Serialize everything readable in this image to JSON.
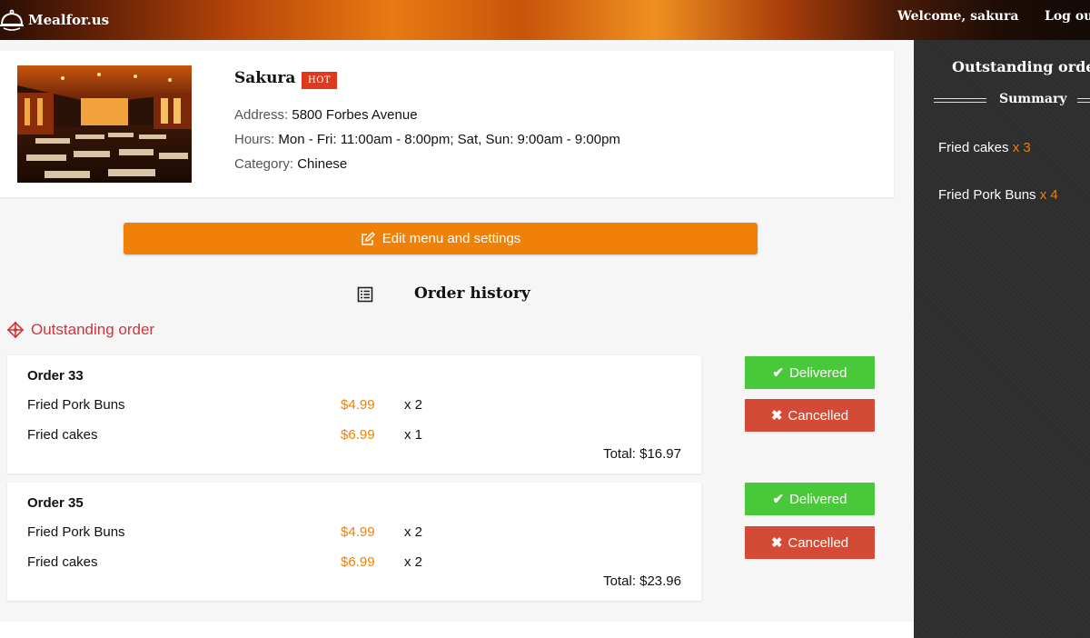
{
  "header": {
    "brand": "Mealfor.us",
    "welcome": "Welcome, sakura",
    "logout": "Log ou"
  },
  "restaurant": {
    "name": "Sakura",
    "badge": "HOT",
    "address_label": "Address:",
    "address": "5800 Forbes Avenue",
    "hours_label": "Hours:",
    "hours": "Mon - Fri: 11:00am - 8:00pm; Sat, Sun: 9:00am - 9:00pm",
    "category_label": "Category:",
    "category": "Chinese"
  },
  "edit_button": "Edit menu and settings",
  "order_history_title": "Order history",
  "outstanding_label": "Outstanding order",
  "orders": [
    {
      "title": "Order 33",
      "items": [
        {
          "name": "Fried Pork Buns",
          "price": "$4.99",
          "qty": "x 2"
        },
        {
          "name": "Fried cakes",
          "price": "$6.99",
          "qty": "x 1"
        }
      ],
      "total": "Total: $16.97",
      "delivered_label": "Delivered",
      "cancelled_label": "Cancelled"
    },
    {
      "title": "Order 35",
      "items": [
        {
          "name": "Fried Pork Buns",
          "price": "$4.99",
          "qty": "x 2"
        },
        {
          "name": "Fried cakes",
          "price": "$6.99",
          "qty": "x 2"
        }
      ],
      "total": "Total: $23.96",
      "delivered_label": "Delivered",
      "cancelled_label": "Cancelled"
    }
  ],
  "sidebar": {
    "title": "Outstanding orde",
    "summary": "Summary",
    "items": [
      {
        "name": "Fried cakes",
        "qty": "x 3"
      },
      {
        "name": "Fried Pork Buns",
        "qty": "x 4"
      }
    ]
  },
  "colors": {
    "accent_orange": "#ef8008",
    "delivered_green": "#49c83a",
    "cancelled_red": "#d34a36",
    "hot_red": "#e03a1e",
    "outstanding_red": "#d2343b",
    "sidebar_dark": "#2e2e2e"
  }
}
